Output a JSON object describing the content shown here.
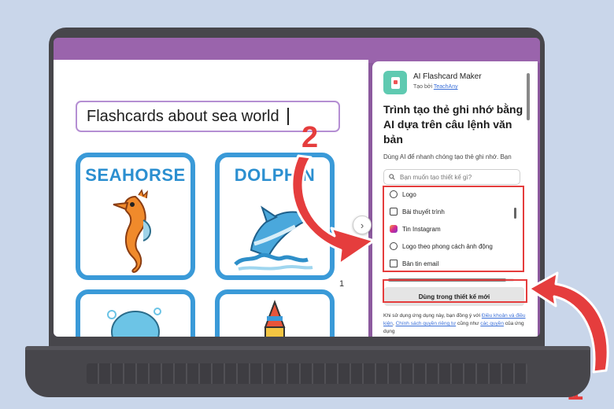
{
  "prompt": {
    "text": "Flashcards about sea world"
  },
  "cards": [
    {
      "title": "SEAHORSE"
    },
    {
      "title": "DOLPHIN"
    }
  ],
  "page_indicator": "1",
  "app": {
    "name": "AI Flashcard Maker",
    "by_prefix": "Tạo bởi",
    "by_link": "TeachAny",
    "title": "Trình tạo thẻ ghi nhớ bằng AI dựa trên câu lệnh văn bản",
    "description": "Dùng AI để nhanh chóng tạo thẻ ghi nhớ. Bạn"
  },
  "search": {
    "placeholder": "Bạn muốn tạo thiết kế gì?"
  },
  "design_types": [
    {
      "label": "Logo",
      "icon": "logo-icon"
    },
    {
      "label": "Bài thuyết trình",
      "icon": "presentation-icon"
    },
    {
      "label": "Tin Instagram",
      "icon": "instagram-icon"
    },
    {
      "label": "Logo theo phong cách ảnh động",
      "icon": "animated-logo-icon"
    },
    {
      "label": "Bản tin email",
      "icon": "email-newsletter-icon"
    }
  ],
  "use_button": {
    "label": "Dùng trong thiết kế mới"
  },
  "terms": {
    "part1": "Khi sử dụng ứng dụng này, bạn đồng ý với ",
    "link1": "Điều khoản và điều kiện",
    "part2": ", ",
    "link2": "Chính sách quyền riêng tư",
    "part3": " cũng như ",
    "link3": "các quyền",
    "part4": " của ứng dụng"
  },
  "annotations": {
    "step1": "1",
    "step2": "2"
  },
  "colors": {
    "highlight": "#e53d3d",
    "card_border": "#3a9ad8",
    "frame_purple": "#9a64ac"
  }
}
